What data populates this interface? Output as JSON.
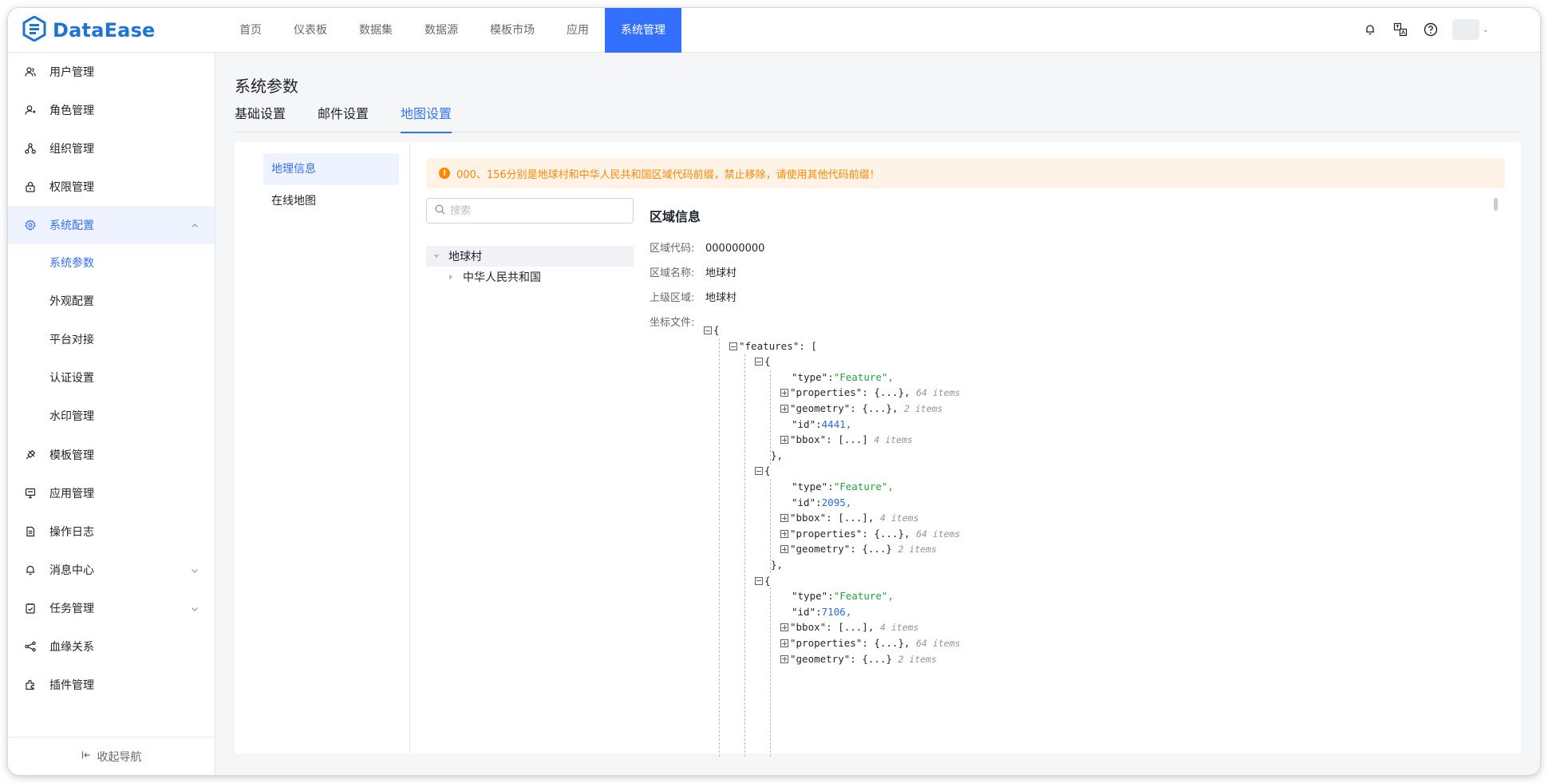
{
  "app": {
    "logo_text": "DataEase",
    "brand_color": "#3370ff",
    "logo_color": "#1e73d6"
  },
  "topnav": {
    "items": [
      "首页",
      "仪表板",
      "数据集",
      "数据源",
      "模板市场",
      "应用",
      "系统管理"
    ],
    "active_index": 6
  },
  "header_icons": [
    "bell-icon",
    "translate-icon",
    "help-icon",
    "avatar"
  ],
  "sidebar": {
    "items": [
      {
        "label": "用户管理",
        "icon": "user-icon"
      },
      {
        "label": "角色管理",
        "icon": "role-icon"
      },
      {
        "label": "组织管理",
        "icon": "org-icon"
      },
      {
        "label": "权限管理",
        "icon": "lock-icon"
      },
      {
        "label": "系统配置",
        "icon": "gear-icon",
        "expanded": true
      },
      {
        "label": "模板管理",
        "icon": "template-icon"
      },
      {
        "label": "应用管理",
        "icon": "app-icon"
      },
      {
        "label": "操作日志",
        "icon": "log-icon"
      },
      {
        "label": "消息中心",
        "icon": "bell-icon",
        "has_children": true
      },
      {
        "label": "任务管理",
        "icon": "task-icon",
        "has_children": true
      },
      {
        "label": "血缘关系",
        "icon": "lineage-icon"
      },
      {
        "label": "插件管理",
        "icon": "plugin-icon"
      }
    ],
    "sub_items": [
      "系统参数",
      "外观配置",
      "平台对接",
      "认证设置",
      "水印管理"
    ],
    "active_sub": "系统参数",
    "collapse_label": "收起导航"
  },
  "page": {
    "title": "系统参数",
    "tabs": [
      "基础设置",
      "邮件设置",
      "地图设置"
    ],
    "active_tab": "地图设置"
  },
  "map_settings": {
    "menu": [
      "地理信息",
      "在线地图"
    ],
    "active_menu": "地理信息",
    "alert": "000、156分别是地球村和中华人民共和国区域代码前缀，禁止移除，请使用其他代码前缀！",
    "alert_color": "#ff8800",
    "search_placeholder": "搜索",
    "tree": [
      {
        "label": "地球村",
        "expanded": true
      },
      {
        "label": "中华人民共和国",
        "expanded": false
      }
    ],
    "detail": {
      "title": "区域信息",
      "fields": [
        {
          "key": "区域代码:",
          "value": "000000000"
        },
        {
          "key": "区域名称:",
          "value": "地球村"
        },
        {
          "key": "上级区域:",
          "value": "地球村"
        },
        {
          "key": "坐标文件:",
          "value": ""
        }
      ]
    },
    "json_preview": {
      "root_open": "{",
      "features_key": "\"features\"",
      "features_open": ": [",
      "features": [
        {
          "close": "},",
          "rows": [
            {
              "kind": "string",
              "key": "\"type\"",
              "value": "\"Feature\","
            },
            {
              "kind": "collapsed",
              "key": "\"properties\"",
              "value": ": {...},",
              "count": "64 items"
            },
            {
              "kind": "collapsed",
              "key": "\"geometry\"",
              "value": ": {...},",
              "count": "2 items"
            },
            {
              "kind": "number",
              "key": "\"id\"",
              "value": "4441,"
            },
            {
              "kind": "collapsed",
              "key": "\"bbox\"",
              "value": ": [...]",
              "count": "4 items"
            }
          ]
        },
        {
          "close": "},",
          "rows": [
            {
              "kind": "string",
              "key": "\"type\"",
              "value": "\"Feature\","
            },
            {
              "kind": "number",
              "key": "\"id\"",
              "value": "2095,"
            },
            {
              "kind": "collapsed",
              "key": "\"bbox\"",
              "value": ": [...],",
              "count": "4 items"
            },
            {
              "kind": "collapsed",
              "key": "\"properties\"",
              "value": ": {...},",
              "count": "64 items"
            },
            {
              "kind": "collapsed",
              "key": "\"geometry\"",
              "value": ": {...}",
              "count": "2 items"
            }
          ]
        },
        {
          "close": "",
          "rows": [
            {
              "kind": "string",
              "key": "\"type\"",
              "value": "\"Feature\","
            },
            {
              "kind": "number",
              "key": "\"id\"",
              "value": "7106,"
            },
            {
              "kind": "collapsed",
              "key": "\"bbox\"",
              "value": ": [...],",
              "count": "4 items"
            },
            {
              "kind": "collapsed",
              "key": "\"properties\"",
              "value": ": {...},",
              "count": "64 items"
            },
            {
              "kind": "collapsed",
              "key": "\"geometry\"",
              "value": ": {...}",
              "count": "2 items"
            }
          ]
        }
      ]
    }
  }
}
